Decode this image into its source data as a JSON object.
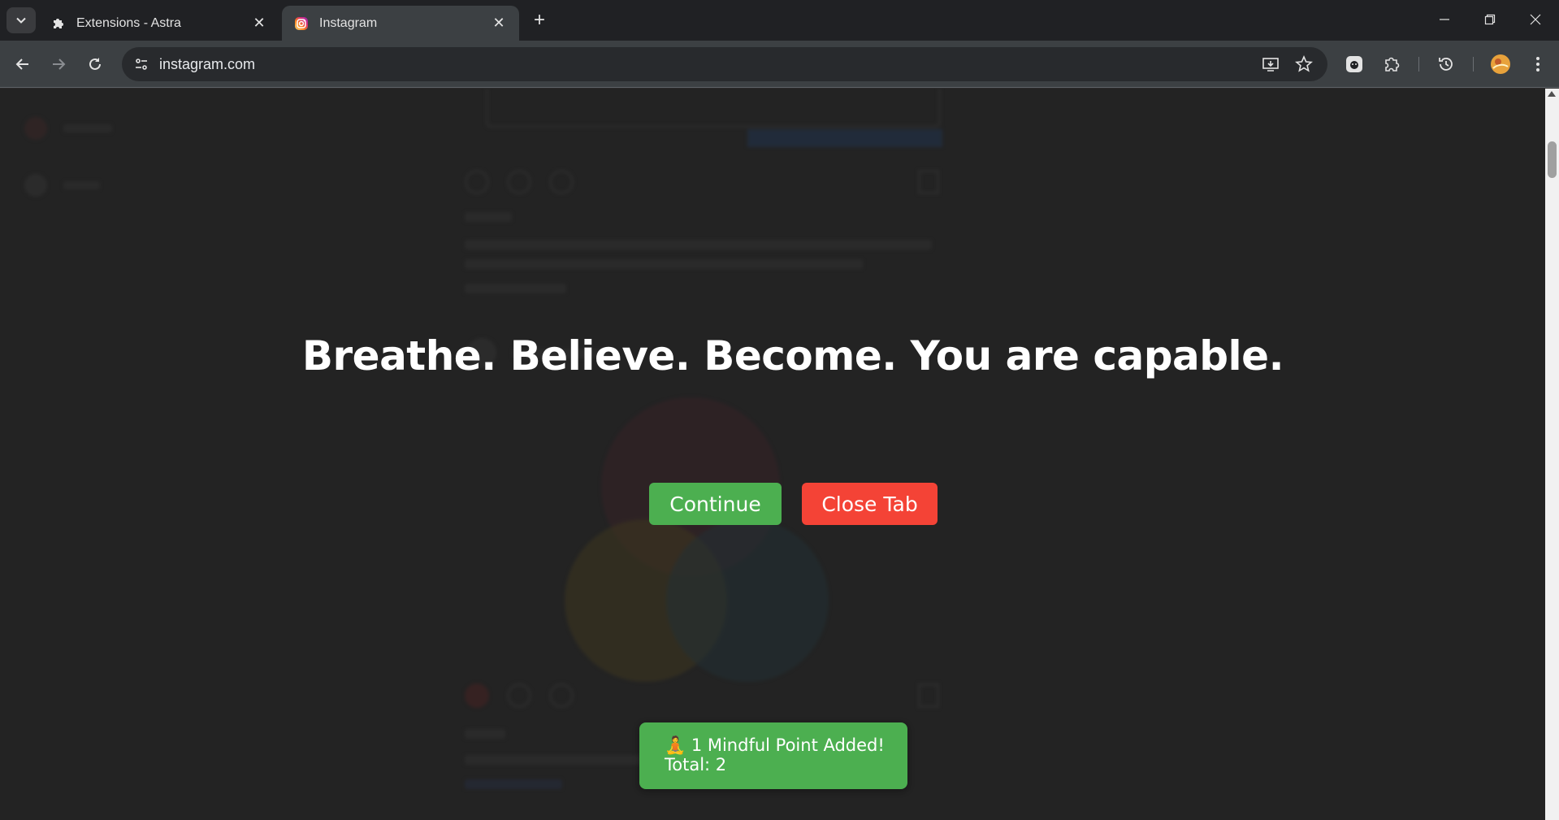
{
  "browser": {
    "tabs": [
      {
        "title": "Extensions - Astra",
        "icon": "puzzle-icon",
        "active": false
      },
      {
        "title": "Instagram",
        "icon": "instagram-icon",
        "active": true
      }
    ],
    "url": "instagram.com"
  },
  "modal": {
    "affirmation": "Breathe. Believe. Become. You are capable.",
    "continue_label": "Continue",
    "close_label": "Close Tab",
    "continue_color": "#4caf50",
    "close_color": "#f44336"
  },
  "toast": {
    "line1": "🧘 1 Mindful Point Added!",
    "line2": "Total: 2",
    "color": "#4caf50"
  }
}
